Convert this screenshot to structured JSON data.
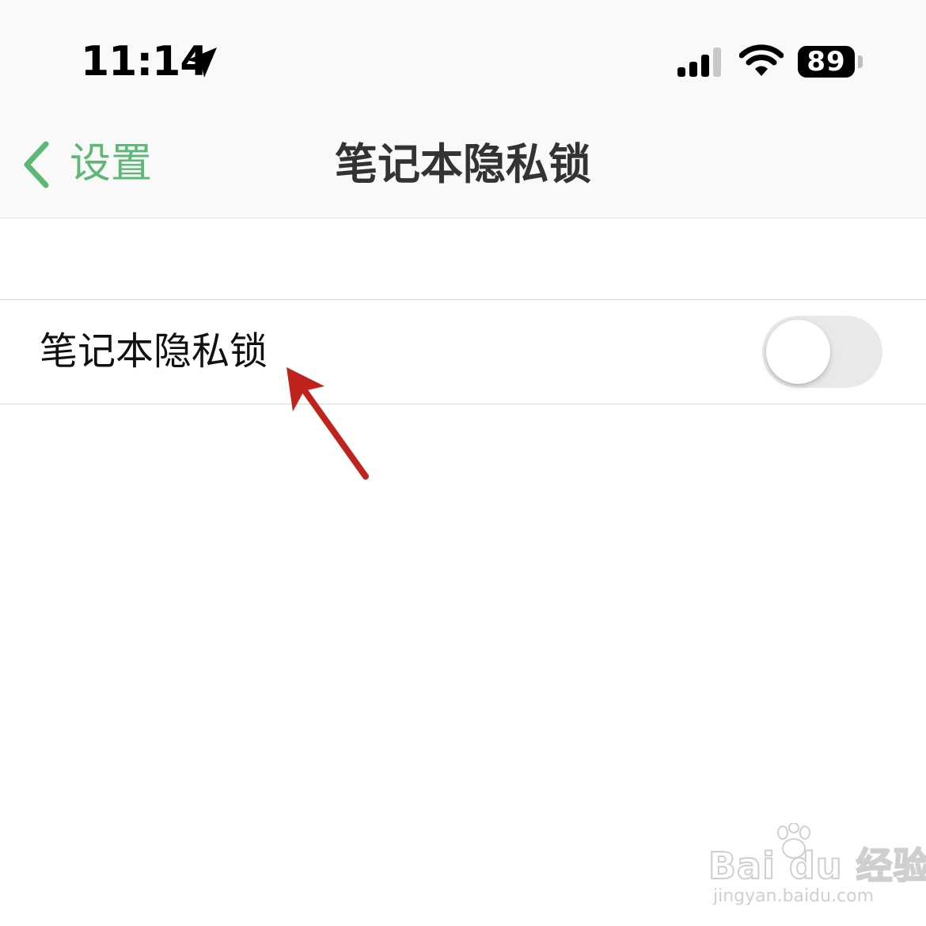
{
  "status_bar": {
    "time": "11:14",
    "battery_level": "89",
    "icons": [
      "location-arrow-icon",
      "cellular-signal-icon",
      "wifi-icon",
      "battery-icon"
    ]
  },
  "nav_bar": {
    "back_label": "设置",
    "title": "笔记本隐私锁",
    "back_icon": "chevron-left-icon"
  },
  "settings": {
    "rows": [
      {
        "label": "笔记本隐私锁",
        "toggle_on": false
      }
    ]
  },
  "watermark": {
    "logo": "Bai du 经验",
    "url": "jingyan.baidu.com"
  },
  "colors": {
    "accent": "#5cb874",
    "nav_background": "#f9f9f9",
    "toggle_off": "#e9e9eb",
    "annotation_arrow": "#c0231c"
  }
}
